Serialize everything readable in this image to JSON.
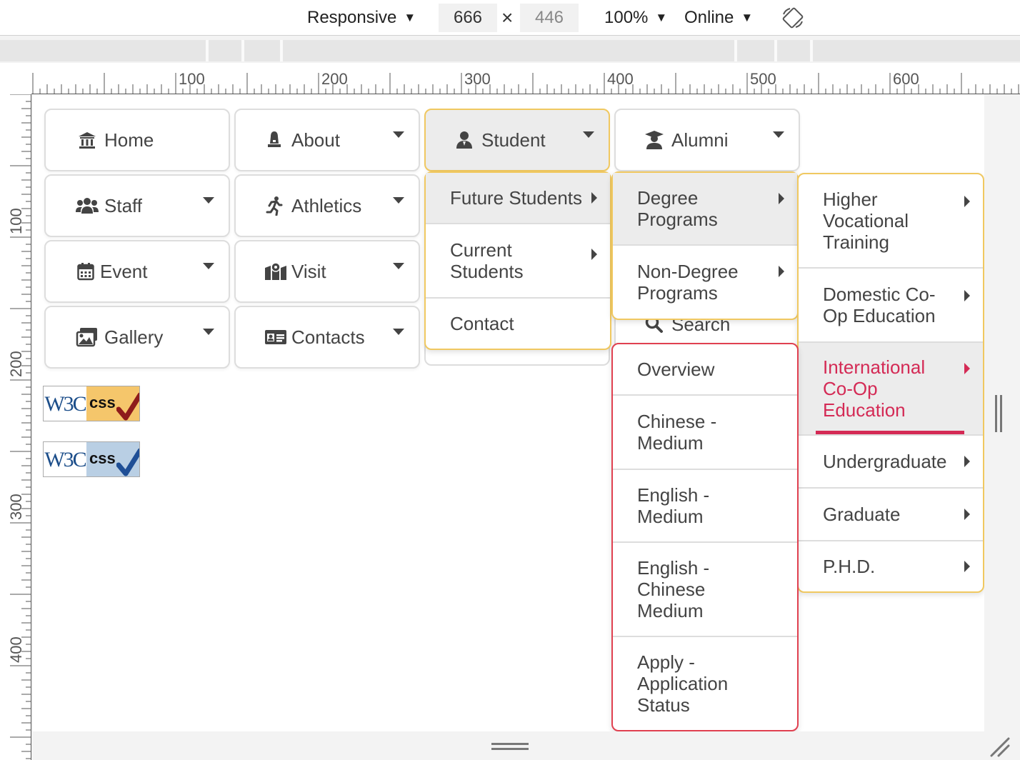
{
  "toolbar": {
    "device": "Responsive",
    "width": "666",
    "height": "446",
    "times": "×",
    "zoom": "100%",
    "network": "Online"
  },
  "ruler": {
    "top_labels": [
      "100",
      "200",
      "300",
      "400",
      "500",
      "600"
    ],
    "left_labels": [
      "100",
      "200",
      "300",
      "400"
    ]
  },
  "menu": {
    "buttons": [
      {
        "label": "Home",
        "icon": "institution-icon"
      },
      {
        "label": "About",
        "icon": "bell-icon"
      },
      {
        "label": "Student",
        "icon": "user-icon"
      },
      {
        "label": "Alumni",
        "icon": "graduate-icon"
      },
      {
        "label": "Staff",
        "icon": "users-icon"
      },
      {
        "label": "Athletics",
        "icon": "running-icon"
      },
      {
        "label": "Event",
        "icon": "calendar-icon"
      },
      {
        "label": "Visit",
        "icon": "map-icon"
      },
      {
        "label": "Gallery",
        "icon": "images-icon"
      },
      {
        "label": "Contacts",
        "icon": "id-card-icon"
      }
    ],
    "student_sub": [
      "Future Students",
      "Current Students",
      "Contact"
    ],
    "future_sub": [
      "Degree Programs",
      "Non-Degree Programs"
    ],
    "search_label": "Search",
    "degree_sub": [
      "Higher Vocational Training",
      "Domestic Co-Op Education",
      "International Co-Op Education",
      "Undergraduate",
      "Graduate",
      "P.H.D."
    ],
    "intl_sub": [
      "Overview",
      "Chinese - Medium",
      "English - Medium",
      "English - Chinese Medium",
      "Apply - Application Status"
    ]
  },
  "badges": {
    "w3c": "W3C",
    "css": "css"
  },
  "colors": {
    "accent_yellow": "#f0c860",
    "accent_red": "#e04050",
    "active_text": "#d42a55",
    "badge1_bg": "#f5c66b",
    "badge2_bg": "#b9cfe4"
  }
}
